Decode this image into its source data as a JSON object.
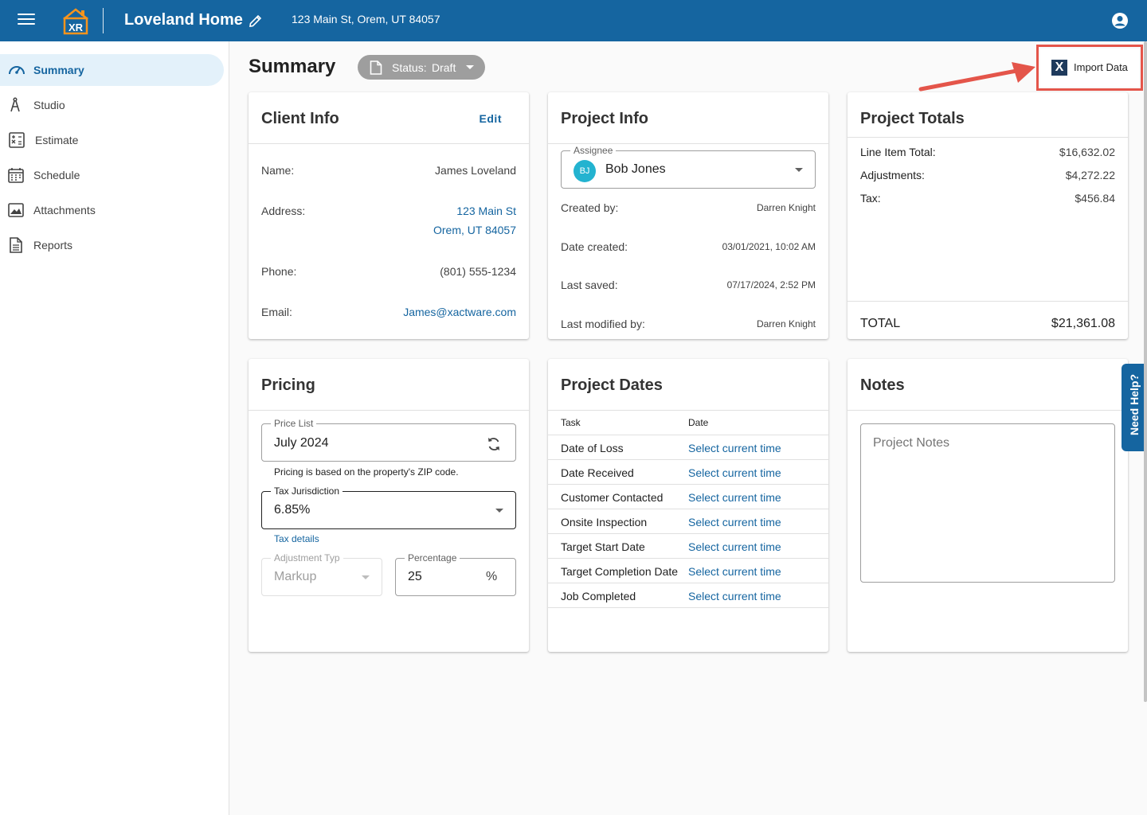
{
  "header": {
    "logo_text": "XR",
    "project_name": "Loveland Home",
    "address": "123 Main St, Orem, UT 84057"
  },
  "sidebar": {
    "items": [
      {
        "label": "Summary",
        "icon": "speedometer-icon",
        "active": true
      },
      {
        "label": "Studio",
        "icon": "compass-icon",
        "active": false
      },
      {
        "label": "Estimate",
        "icon": "calculator-icon",
        "active": false
      },
      {
        "label": "Schedule",
        "icon": "calendar-icon",
        "active": false
      },
      {
        "label": "Attachments",
        "icon": "image-icon",
        "active": false
      },
      {
        "label": "Reports",
        "icon": "document-icon",
        "active": false
      }
    ]
  },
  "page": {
    "title": "Summary",
    "status_label": "Status:",
    "status_value": "Draft",
    "import_label": "Import Data"
  },
  "client_info": {
    "title": "Client Info",
    "edit_label": "Edit",
    "name_label": "Name:",
    "name_value": "James Loveland",
    "address_label": "Address:",
    "address_line1": "123 Main St",
    "address_line2": "Orem, UT 84057",
    "phone_label": "Phone:",
    "phone_value": "(801) 555-1234",
    "email_label": "Email:",
    "email_value": "James@xactware.com"
  },
  "project_info": {
    "title": "Project Info",
    "assignee_legend": "Assignee",
    "assignee_initials": "BJ",
    "assignee_name": "Bob Jones",
    "created_by_label": "Created by:",
    "created_by_value": "Darren Knight",
    "date_created_label": "Date created:",
    "date_created_value": "03/01/2021, 10:02 AM",
    "last_saved_label": "Last saved:",
    "last_saved_value": "07/17/2024, 2:52 PM",
    "last_modified_label": "Last modified by:",
    "last_modified_value": "Darren Knight"
  },
  "project_totals": {
    "title": "Project Totals",
    "line_item_label": "Line Item Total:",
    "line_item_value": "$16,632.02",
    "adjustments_label": "Adjustments:",
    "adjustments_value": "$4,272.22",
    "tax_label": "Tax:",
    "tax_value": "$456.84",
    "total_label": "TOTAL",
    "total_value": "$21,361.08"
  },
  "pricing": {
    "title": "Pricing",
    "price_list_legend": "Price List",
    "price_list_value": "July 2024",
    "price_list_helper": "Pricing is based on the property's ZIP code.",
    "tax_legend": "Tax Jurisdiction",
    "tax_value": "6.85%",
    "tax_details_link": "Tax details",
    "adjustment_legend": "Adjustment Typ",
    "adjustment_value": "Markup",
    "percentage_legend": "Percentage",
    "percentage_value": "25",
    "percentage_suffix": "%"
  },
  "project_dates": {
    "title": "Project Dates",
    "col_task": "Task",
    "col_date": "Date",
    "rows": [
      {
        "task": "Date of Loss",
        "date": "Select current time"
      },
      {
        "task": "Date Received",
        "date": "Select current time"
      },
      {
        "task": "Customer Contacted",
        "date": "Select current time"
      },
      {
        "task": "Onsite Inspection",
        "date": "Select current time"
      },
      {
        "task": "Target Start Date",
        "date": "Select current time"
      },
      {
        "task": "Target Completion Date",
        "date": "Select current time"
      },
      {
        "task": "Job Completed",
        "date": "Select current time"
      }
    ]
  },
  "notes": {
    "title": "Notes",
    "placeholder": "Project Notes"
  },
  "help": {
    "label": "Need Help?"
  },
  "colors": {
    "primary": "#1565a0",
    "highlight": "#e4554a",
    "status_chip": "#9e9e9e",
    "avatar": "#23b3d0"
  }
}
